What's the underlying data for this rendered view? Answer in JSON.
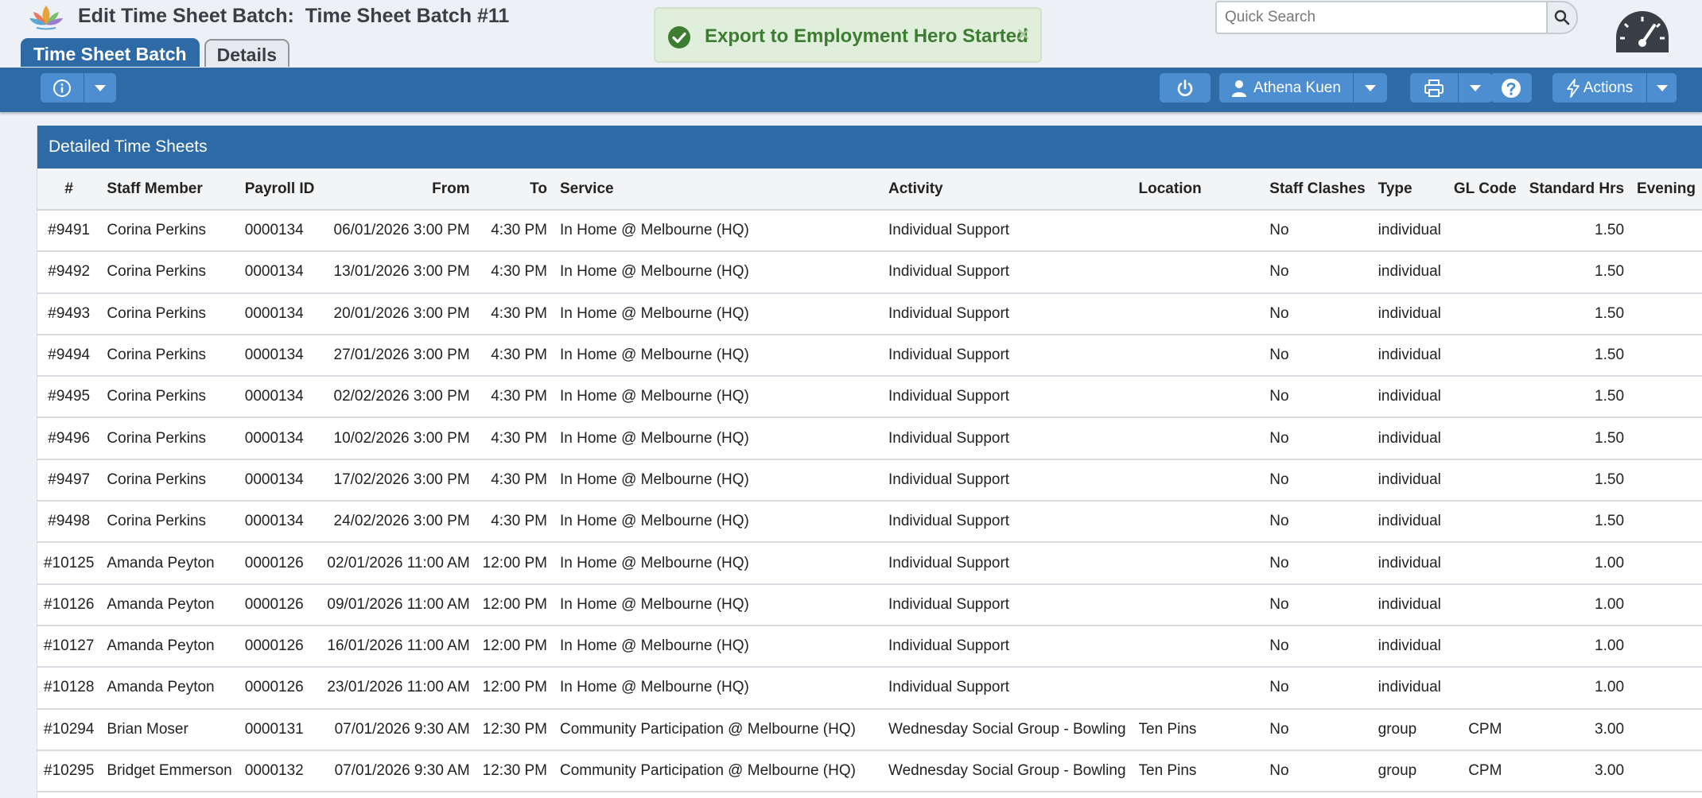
{
  "header": {
    "title": "Edit Time Sheet Batch:  Time Sheet Batch #11",
    "tabs": [
      {
        "label": "Time Sheet Batch",
        "active": true
      },
      {
        "label": "Details",
        "active": false
      }
    ],
    "logo_icon": "lotus-logo-icon"
  },
  "toast": {
    "message": "Export to Employment Hero Started",
    "close": "×",
    "color": "#3d7d32"
  },
  "search": {
    "placeholder": "Quick Search",
    "value": ""
  },
  "toolbar": {
    "user_name": "Athena Kuen",
    "actions_label": "Actions",
    "accent": "#2e6aa5",
    "button_color": "#4d8ed1"
  },
  "panel": {
    "title": "Detailed Time Sheets"
  },
  "table": {
    "columns": [
      "#",
      "Staff Member",
      "Payroll ID",
      "From",
      "To",
      "Service",
      "Activity",
      "Location",
      "Staff Clashes",
      "Type",
      "GL Code",
      "Standard Hrs",
      "Evening"
    ],
    "rows": [
      [
        "#9491",
        "Corina Perkins",
        "0000134",
        "06/01/2026 3:00 PM",
        "4:30 PM",
        "In Home @ Melbourne (HQ)",
        "Individual Support",
        "",
        "No",
        "individual",
        "",
        "1.50"
      ],
      [
        "#9492",
        "Corina Perkins",
        "0000134",
        "13/01/2026 3:00 PM",
        "4:30 PM",
        "In Home @ Melbourne (HQ)",
        "Individual Support",
        "",
        "No",
        "individual",
        "",
        "1.50"
      ],
      [
        "#9493",
        "Corina Perkins",
        "0000134",
        "20/01/2026 3:00 PM",
        "4:30 PM",
        "In Home @ Melbourne (HQ)",
        "Individual Support",
        "",
        "No",
        "individual",
        "",
        "1.50"
      ],
      [
        "#9494",
        "Corina Perkins",
        "0000134",
        "27/01/2026 3:00 PM",
        "4:30 PM",
        "In Home @ Melbourne (HQ)",
        "Individual Support",
        "",
        "No",
        "individual",
        "",
        "1.50"
      ],
      [
        "#9495",
        "Corina Perkins",
        "0000134",
        "02/02/2026 3:00 PM",
        "4:30 PM",
        "In Home @ Melbourne (HQ)",
        "Individual Support",
        "",
        "No",
        "individual",
        "",
        "1.50"
      ],
      [
        "#9496",
        "Corina Perkins",
        "0000134",
        "10/02/2026 3:00 PM",
        "4:30 PM",
        "In Home @ Melbourne (HQ)",
        "Individual Support",
        "",
        "No",
        "individual",
        "",
        "1.50"
      ],
      [
        "#9497",
        "Corina Perkins",
        "0000134",
        "17/02/2026 3:00 PM",
        "4:30 PM",
        "In Home @ Melbourne (HQ)",
        "Individual Support",
        "",
        "No",
        "individual",
        "",
        "1.50"
      ],
      [
        "#9498",
        "Corina Perkins",
        "0000134",
        "24/02/2026 3:00 PM",
        "4:30 PM",
        "In Home @ Melbourne (HQ)",
        "Individual Support",
        "",
        "No",
        "individual",
        "",
        "1.50"
      ],
      [
        "#10125",
        "Amanda Peyton",
        "0000126",
        "02/01/2026 11:00 AM",
        "12:00 PM",
        "In Home @ Melbourne (HQ)",
        "Individual Support",
        "",
        "No",
        "individual",
        "",
        "1.00"
      ],
      [
        "#10126",
        "Amanda Peyton",
        "0000126",
        "09/01/2026 11:00 AM",
        "12:00 PM",
        "In Home @ Melbourne (HQ)",
        "Individual Support",
        "",
        "No",
        "individual",
        "",
        "1.00"
      ],
      [
        "#10127",
        "Amanda Peyton",
        "0000126",
        "16/01/2026 11:00 AM",
        "12:00 PM",
        "In Home @ Melbourne (HQ)",
        "Individual Support",
        "",
        "No",
        "individual",
        "",
        "1.00"
      ],
      [
        "#10128",
        "Amanda Peyton",
        "0000126",
        "23/01/2026 11:00 AM",
        "12:00 PM",
        "In Home @ Melbourne (HQ)",
        "Individual Support",
        "",
        "No",
        "individual",
        "",
        "1.00"
      ],
      [
        "#10294",
        "Brian Moser",
        "0000131",
        "07/01/2026 9:30 AM",
        "12:30 PM",
        "Community Participation @ Melbourne (HQ)",
        "Wednesday Social Group - Bowling",
        "Ten Pins",
        "No",
        "group",
        "CPM",
        "3.00"
      ],
      [
        "#10295",
        "Bridget Emmerson",
        "0000132",
        "07/01/2026 9:30 AM",
        "12:30 PM",
        "Community Participation @ Melbourne (HQ)",
        "Wednesday Social Group - Bowling",
        "Ten Pins",
        "No",
        "group",
        "CPM",
        "3.00"
      ]
    ]
  }
}
